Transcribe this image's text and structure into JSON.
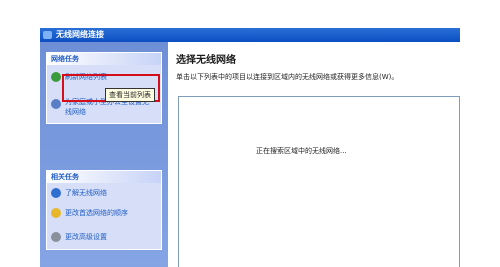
{
  "window": {
    "title": "无线网络连接"
  },
  "tasks_group": {
    "header": "网络任务",
    "items": [
      {
        "label": "刷新网络列表",
        "icon": "refresh-icon"
      },
      {
        "label": "为家庭或小型办公室设置无线网络",
        "icon": "setup-wireless-icon"
      }
    ]
  },
  "tooltip": "查看当前列表",
  "related_group": {
    "header": "相关任务",
    "items": [
      {
        "label": "了解无线网络",
        "icon": "info-icon"
      },
      {
        "label": "更改首选网络的顺序",
        "icon": "star-icon"
      },
      {
        "label": "更改高级设置",
        "icon": "settings-icon"
      }
    ]
  },
  "main": {
    "title": "选择无线网络",
    "instruction": "单击以下列表中的项目以连接到区域内的无线网络或获得更多信息(W)。",
    "status": "正在搜索区域中的无线网络..."
  },
  "colors": {
    "link": "#215dc6",
    "highlight": "#d40e1a"
  }
}
